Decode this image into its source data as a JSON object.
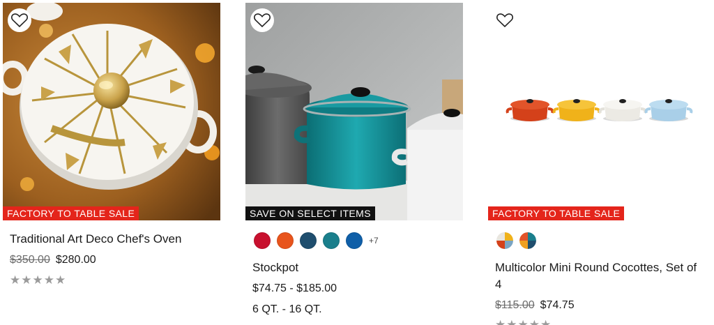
{
  "colors": {
    "badge_red": "#e4251b",
    "badge_black": "#111111",
    "text": "#1a1a1a",
    "muted": "#6b6b6b",
    "star": "#9a9a9a"
  },
  "products": [
    {
      "badge": "FACTORY TO TABLE SALE",
      "title": "Traditional Art Deco Chef's Oven",
      "old_price": "$350.00",
      "price": "$280.00",
      "stars": "★★★★★",
      "rating": 0,
      "favorite_icon": "heart-outline-icon"
    },
    {
      "badge": "SAVE ON SELECT ITEMS",
      "title": "Stockpot",
      "price_range": "$74.75 - $185.00",
      "size_range": "6 QT. - 16 QT.",
      "swatches": [
        "#c8102e",
        "#e8541c",
        "#1f4e6e",
        "#1a7f8c",
        "#0f5fa8"
      ],
      "more_colors": "+7",
      "favorite_icon": "heart-outline-icon"
    },
    {
      "badge": "FACTORY TO TABLE SALE",
      "title": "Multicolor Mini Round Cocottes, Set of 4",
      "old_price": "$115.00",
      "price": "$74.75",
      "stars": "★★★★★",
      "swatches": [
        "multicolor-warm",
        "multicolor-cool"
      ],
      "favorite_icon": "heart-outline-icon"
    }
  ]
}
